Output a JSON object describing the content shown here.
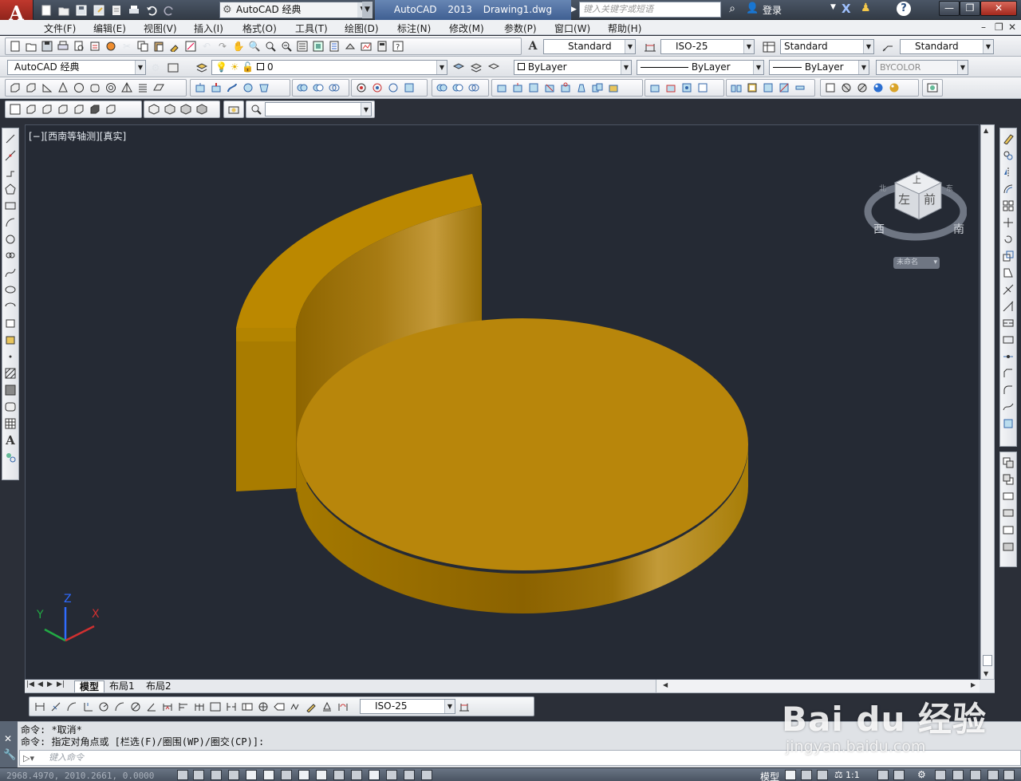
{
  "window": {
    "app_name": "AutoCAD 2013",
    "file_name": "Drawing1.dwg",
    "title": "AutoCAD 2013    Drawing1.dwg",
    "workspace": "AutoCAD 经典",
    "search_placeholder": "键入关键字或短语",
    "signin": "登录"
  },
  "menu": [
    "文件(F)",
    "编辑(E)",
    "视图(V)",
    "插入(I)",
    "格式(O)",
    "工具(T)",
    "绘图(D)",
    "标注(N)",
    "修改(M)",
    "参数(P)",
    "窗口(W)",
    "帮助(H)"
  ],
  "styles": {
    "text_style": "Standard",
    "dim_style": "ISO-25",
    "table_style": "Standard",
    "multileader_style": "Standard"
  },
  "layers": {
    "workspace": "AutoCAD 经典",
    "current_layer": "0",
    "color": "ByLayer",
    "linetype": "ByLayer",
    "lineweight": "ByLayer",
    "plot_style": "BYCOLOR"
  },
  "viewport": {
    "label": "[−][西南等轴测][真实]",
    "viewcube_faces": {
      "top": "上",
      "left": "左",
      "front": "前"
    },
    "viewcube_compass": {
      "w": "西",
      "s": "南",
      "n": "北",
      "e": "东"
    },
    "ucs_label": "未命名",
    "solid_color": "#b8860b",
    "background_color": "#252a34"
  },
  "ucs_icon": {
    "x": "X",
    "y": "Y",
    "z": "Z"
  },
  "tabs": [
    "模型",
    "布局1",
    "布局2"
  ],
  "dim_toolbar": {
    "dim_style": "ISO-25"
  },
  "command": {
    "history": [
      "命令: *取消*",
      "命令: 指定对角点或 [栏选(F)/圈围(WP)/圈交(CP)]:"
    ],
    "input_placeholder": "键入命令"
  },
  "status": {
    "coordinates": "2968.4970, 2010.2661, 0.0000",
    "model": "模型",
    "scale": "1:1"
  },
  "watermark": {
    "main": "Bai du 经验",
    "sub": "jingyan.baidu.com"
  }
}
